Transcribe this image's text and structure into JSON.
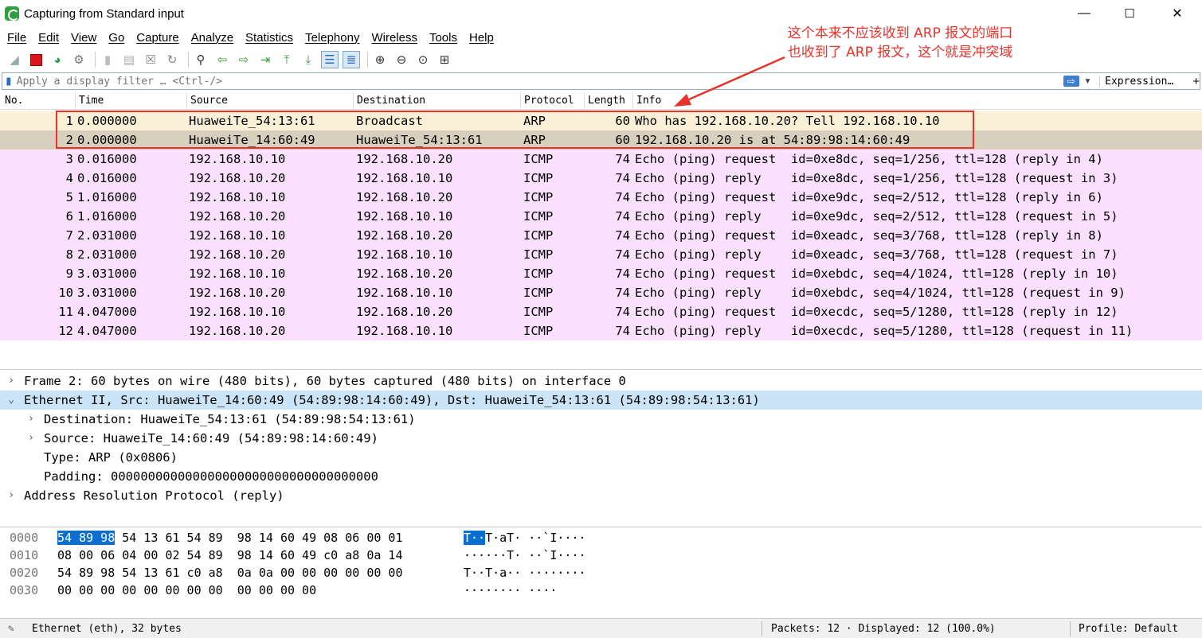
{
  "window": {
    "title": "Capturing from Standard input",
    "minimize": "—",
    "maximize": "☐",
    "close": "✕"
  },
  "menu": [
    "File",
    "Edit",
    "View",
    "Go",
    "Capture",
    "Analyze",
    "Statistics",
    "Telephony",
    "Wireless",
    "Tools",
    "Help"
  ],
  "filter": {
    "placeholder": "Apply a display filter … <Ctrl-/>",
    "expression_label": "Expression…",
    "plus_label": "+"
  },
  "columns": [
    "No.",
    "Time",
    "Source",
    "Destination",
    "Protocol",
    "Length",
    "Info"
  ],
  "packets": [
    {
      "no": "1",
      "time": "0.000000",
      "src": "HuaweiTe_54:13:61",
      "dst": "Broadcast",
      "proto": "ARP",
      "len": "60",
      "info": "Who has 192.168.10.20? Tell 192.168.10.10",
      "color": "#faf0d7"
    },
    {
      "no": "2",
      "time": "0.000000",
      "src": "HuaweiTe_14:60:49",
      "dst": "HuaweiTe_54:13:61",
      "proto": "ARP",
      "len": "60",
      "info": "192.168.10.20 is at 54:89:98:14:60:49",
      "color": "#d8cfbd"
    },
    {
      "no": "3",
      "time": "0.016000",
      "src": "192.168.10.10",
      "dst": "192.168.10.20",
      "proto": "ICMP",
      "len": "74",
      "info": "Echo (ping) request  id=0xe8dc, seq=1/256, ttl=128 (reply in 4)",
      "color": "#fce0ff"
    },
    {
      "no": "4",
      "time": "0.016000",
      "src": "192.168.10.20",
      "dst": "192.168.10.10",
      "proto": "ICMP",
      "len": "74",
      "info": "Echo (ping) reply    id=0xe8dc, seq=1/256, ttl=128 (request in 3)",
      "color": "#fce0ff"
    },
    {
      "no": "5",
      "time": "1.016000",
      "src": "192.168.10.10",
      "dst": "192.168.10.20",
      "proto": "ICMP",
      "len": "74",
      "info": "Echo (ping) request  id=0xe9dc, seq=2/512, ttl=128 (reply in 6)",
      "color": "#fce0ff"
    },
    {
      "no": "6",
      "time": "1.016000",
      "src": "192.168.10.20",
      "dst": "192.168.10.10",
      "proto": "ICMP",
      "len": "74",
      "info": "Echo (ping) reply    id=0xe9dc, seq=2/512, ttl=128 (request in 5)",
      "color": "#fce0ff"
    },
    {
      "no": "7",
      "time": "2.031000",
      "src": "192.168.10.10",
      "dst": "192.168.10.20",
      "proto": "ICMP",
      "len": "74",
      "info": "Echo (ping) request  id=0xeadc, seq=3/768, ttl=128 (reply in 8)",
      "color": "#fce0ff"
    },
    {
      "no": "8",
      "time": "2.031000",
      "src": "192.168.10.20",
      "dst": "192.168.10.10",
      "proto": "ICMP",
      "len": "74",
      "info": "Echo (ping) reply    id=0xeadc, seq=3/768, ttl=128 (request in 7)",
      "color": "#fce0ff"
    },
    {
      "no": "9",
      "time": "3.031000",
      "src": "192.168.10.10",
      "dst": "192.168.10.20",
      "proto": "ICMP",
      "len": "74",
      "info": "Echo (ping) request  id=0xebdc, seq=4/1024, ttl=128 (reply in 10)",
      "color": "#fce0ff"
    },
    {
      "no": "10",
      "time": "3.031000",
      "src": "192.168.10.20",
      "dst": "192.168.10.10",
      "proto": "ICMP",
      "len": "74",
      "info": "Echo (ping) reply    id=0xebdc, seq=4/1024, ttl=128 (request in 9)",
      "color": "#fce0ff"
    },
    {
      "no": "11",
      "time": "4.047000",
      "src": "192.168.10.10",
      "dst": "192.168.10.20",
      "proto": "ICMP",
      "len": "74",
      "info": "Echo (ping) request  id=0xecdc, seq=5/1280, ttl=128 (reply in 12)",
      "color": "#fce0ff"
    },
    {
      "no": "12",
      "time": "4.047000",
      "src": "192.168.10.20",
      "dst": "192.168.10.10",
      "proto": "ICMP",
      "len": "74",
      "info": "Echo (ping) reply    id=0xecdc, seq=5/1280, ttl=128 (request in 11)",
      "color": "#fce0ff"
    }
  ],
  "details": [
    {
      "text": "Frame 2: 60 bytes on wire (480 bits), 60 bytes captured (480 bits) on interface 0",
      "arrow": "›",
      "indent": 0,
      "selected": false
    },
    {
      "text": "Ethernet II, Src: HuaweiTe_14:60:49 (54:89:98:14:60:49), Dst: HuaweiTe_54:13:61 (54:89:98:54:13:61)",
      "arrow": "⌄",
      "indent": 0,
      "selected": true
    },
    {
      "text": "Destination: HuaweiTe_54:13:61 (54:89:98:54:13:61)",
      "arrow": "›",
      "indent": 1,
      "selected": false
    },
    {
      "text": "Source: HuaweiTe_14:60:49 (54:89:98:14:60:49)",
      "arrow": "›",
      "indent": 1,
      "selected": false
    },
    {
      "text": "Type: ARP (0x0806)",
      "arrow": "",
      "indent": 1,
      "selected": false
    },
    {
      "text": "Padding: 000000000000000000000000000000000000",
      "arrow": "",
      "indent": 1,
      "selected": false
    },
    {
      "text": "Address Resolution Protocol (reply)",
      "arrow": "›",
      "indent": 0,
      "selected": false
    }
  ],
  "bytes": [
    {
      "offset": "0000",
      "hex_hl": "54 89 98",
      "hex": " 54 13 61 54 89  98 14 60 49 08 06 00 01",
      "ascii_hl": "T··",
      "ascii": "T·aT· ··`I····"
    },
    {
      "offset": "0010",
      "hex_hl": "",
      "hex": "08 00 06 04 00 02 54 89  98 14 60 49 c0 a8 0a 14",
      "ascii_hl": "",
      "ascii": "······T· ··`I····"
    },
    {
      "offset": "0020",
      "hex_hl": "",
      "hex": "54 89 98 54 13 61 c0 a8  0a 0a 00 00 00 00 00 00",
      "ascii_hl": "",
      "ascii": "T··T·a·· ········"
    },
    {
      "offset": "0030",
      "hex_hl": "",
      "hex": "00 00 00 00 00 00 00 00  00 00 00 00",
      "ascii_hl": "",
      "ascii": "········ ····"
    }
  ],
  "status": {
    "left": "Ethernet (eth), 32 bytes",
    "packets": "Packets: 12 · Displayed: 12 (100.0%)",
    "profile": "Profile: Default"
  },
  "annotation": {
    "line1": "这个本来不应该收到 ARP 报文的端口",
    "line2": "也收到了 ARP 报文，这个就是冲突域",
    "color": "#e8332b"
  }
}
